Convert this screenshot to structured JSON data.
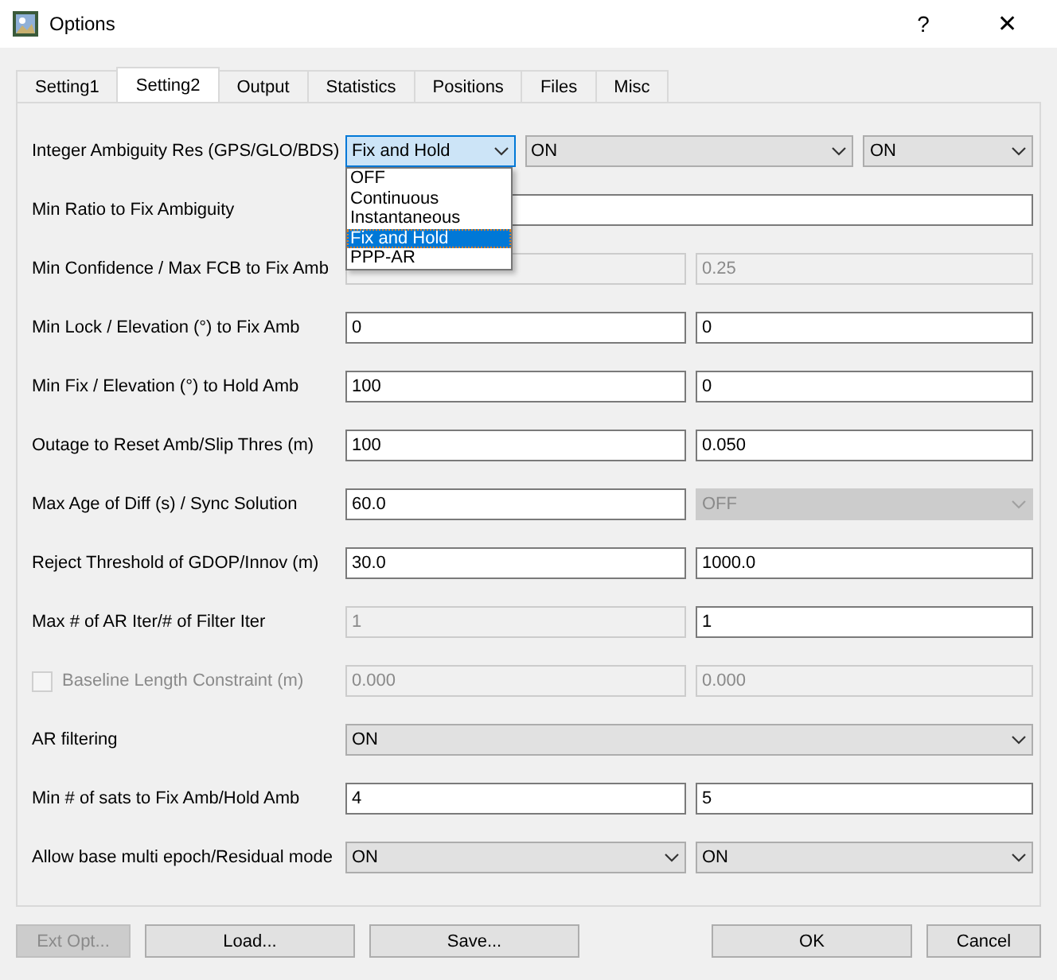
{
  "window": {
    "title": "Options",
    "help": "?",
    "close": "✕"
  },
  "tabs": [
    {
      "label": "Setting1",
      "selected": false
    },
    {
      "label": "Setting2",
      "selected": true
    },
    {
      "label": "Output",
      "selected": false
    },
    {
      "label": "Statistics",
      "selected": false
    },
    {
      "label": "Positions",
      "selected": false
    },
    {
      "label": "Files",
      "selected": false
    },
    {
      "label": "Misc",
      "selected": false
    }
  ],
  "rows": [
    {
      "label": "Integer Ambiguity Res (GPS/GLO/BDS)",
      "fields": [
        {
          "kind": "combo",
          "value": "Fix and Hold",
          "disabled": false,
          "focused": true,
          "expanded": true,
          "options": [
            {
              "label": "OFF",
              "selected": false
            },
            {
              "label": "Continuous",
              "selected": false
            },
            {
              "label": "Instantaneous",
              "selected": false
            },
            {
              "label": "Fix and Hold",
              "selected": true
            },
            {
              "label": "PPP-AR",
              "selected": false
            }
          ]
        },
        {
          "kind": "combo",
          "value": "ON",
          "disabled": false
        },
        {
          "kind": "combo",
          "value": "ON",
          "disabled": false
        }
      ]
    },
    {
      "label": "Min Ratio to Fix Ambiguity",
      "fields": [
        {
          "kind": "input",
          "disabled": false
        }
      ]
    },
    {
      "label": "Min Confidence / Max FCB to Fix Amb",
      "fields": [
        {
          "kind": "input",
          "disabled": true
        },
        {
          "kind": "input",
          "value": "0.25",
          "disabled": true
        }
      ]
    },
    {
      "label": "Min Lock / Elevation (°) to Fix Amb",
      "fields": [
        {
          "kind": "input",
          "value": "0",
          "disabled": false
        },
        {
          "kind": "input",
          "value": "0",
          "disabled": false
        }
      ]
    },
    {
      "label": "Min Fix / Elevation (°) to Hold Amb",
      "fields": [
        {
          "kind": "input",
          "value": "100",
          "disabled": false
        },
        {
          "kind": "input",
          "value": "0",
          "disabled": false
        }
      ]
    },
    {
      "label": "Outage to Reset Amb/Slip Thres (m)",
      "fields": [
        {
          "kind": "input",
          "value": "100",
          "disabled": false
        },
        {
          "kind": "input",
          "value": "0.050",
          "disabled": false
        }
      ]
    },
    {
      "label": "Max Age of Diff (s) / Sync Solution",
      "fields": [
        {
          "kind": "input",
          "value": "60.0",
          "disabled": false
        },
        {
          "kind": "combo",
          "value": "OFF",
          "disabled": true
        }
      ]
    },
    {
      "label": "Reject Threshold of GDOP/Innov (m)",
      "fields": [
        {
          "kind": "input",
          "value": "30.0",
          "disabled": false
        },
        {
          "kind": "input",
          "value": "1000.0",
          "disabled": false
        }
      ]
    },
    {
      "label": "Max # of AR Iter/# of Filter Iter",
      "fields": [
        {
          "kind": "input",
          "value": "1",
          "disabled": true
        },
        {
          "kind": "input",
          "value": "1",
          "disabled": false
        }
      ]
    },
    {
      "label": "Baseline Length Constraint (m)",
      "checkbox": {
        "checked": false,
        "disabled": true
      },
      "fields": [
        {
          "kind": "input",
          "value": "0.000",
          "disabled": true
        },
        {
          "kind": "input",
          "value": "0.000",
          "disabled": true
        }
      ]
    },
    {
      "label": "AR filtering",
      "fields": [
        {
          "kind": "combo",
          "value": "ON",
          "disabled": false
        }
      ]
    },
    {
      "label": "Min # of sats to Fix Amb/Hold Amb",
      "fields": [
        {
          "kind": "input",
          "value": "4",
          "disabled": false
        },
        {
          "kind": "input",
          "value": "5",
          "disabled": false
        }
      ]
    },
    {
      "label": "Allow base multi epoch/Residual mode",
      "fields": [
        {
          "kind": "combo",
          "value": "ON",
          "disabled": false
        },
        {
          "kind": "combo",
          "value": "ON",
          "disabled": false
        }
      ]
    }
  ],
  "buttons_left": [
    {
      "label": "Ext Opt...",
      "disabled": true
    },
    {
      "label": "Load...",
      "disabled": false
    },
    {
      "label": "Save...",
      "disabled": false
    }
  ],
  "buttons_right": [
    {
      "label": "OK",
      "disabled": false
    },
    {
      "label": "Cancel",
      "disabled": false
    }
  ]
}
